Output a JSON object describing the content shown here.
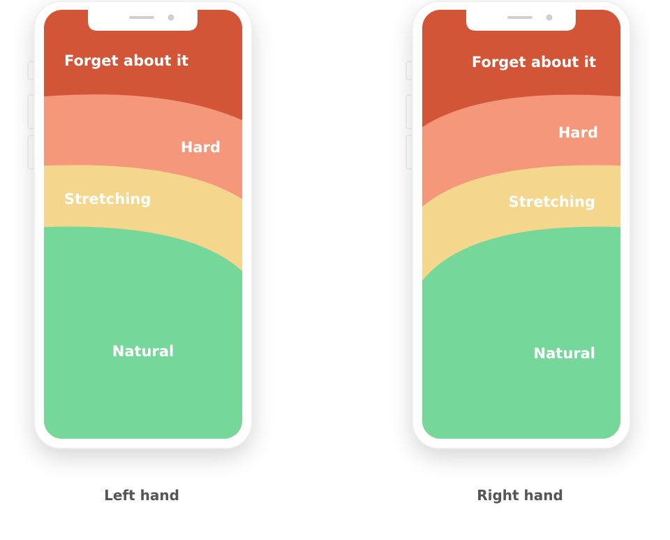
{
  "colors": {
    "forget": "#d35537",
    "hard": "#f4977a",
    "stretching": "#f4d68c",
    "natural": "#76d79b",
    "frame": "#ffffff",
    "caption": "#555555"
  },
  "left_phone": {
    "zones": {
      "forget": "Forget about it",
      "hard": "Hard",
      "stretching": "Stretching",
      "natural": "Natural"
    },
    "caption": "Left hand"
  },
  "right_phone": {
    "zones": {
      "forget": "Forget about it",
      "hard": "Hard",
      "stretching": "Stretching",
      "natural": "Natural"
    },
    "caption": "Right hand"
  }
}
